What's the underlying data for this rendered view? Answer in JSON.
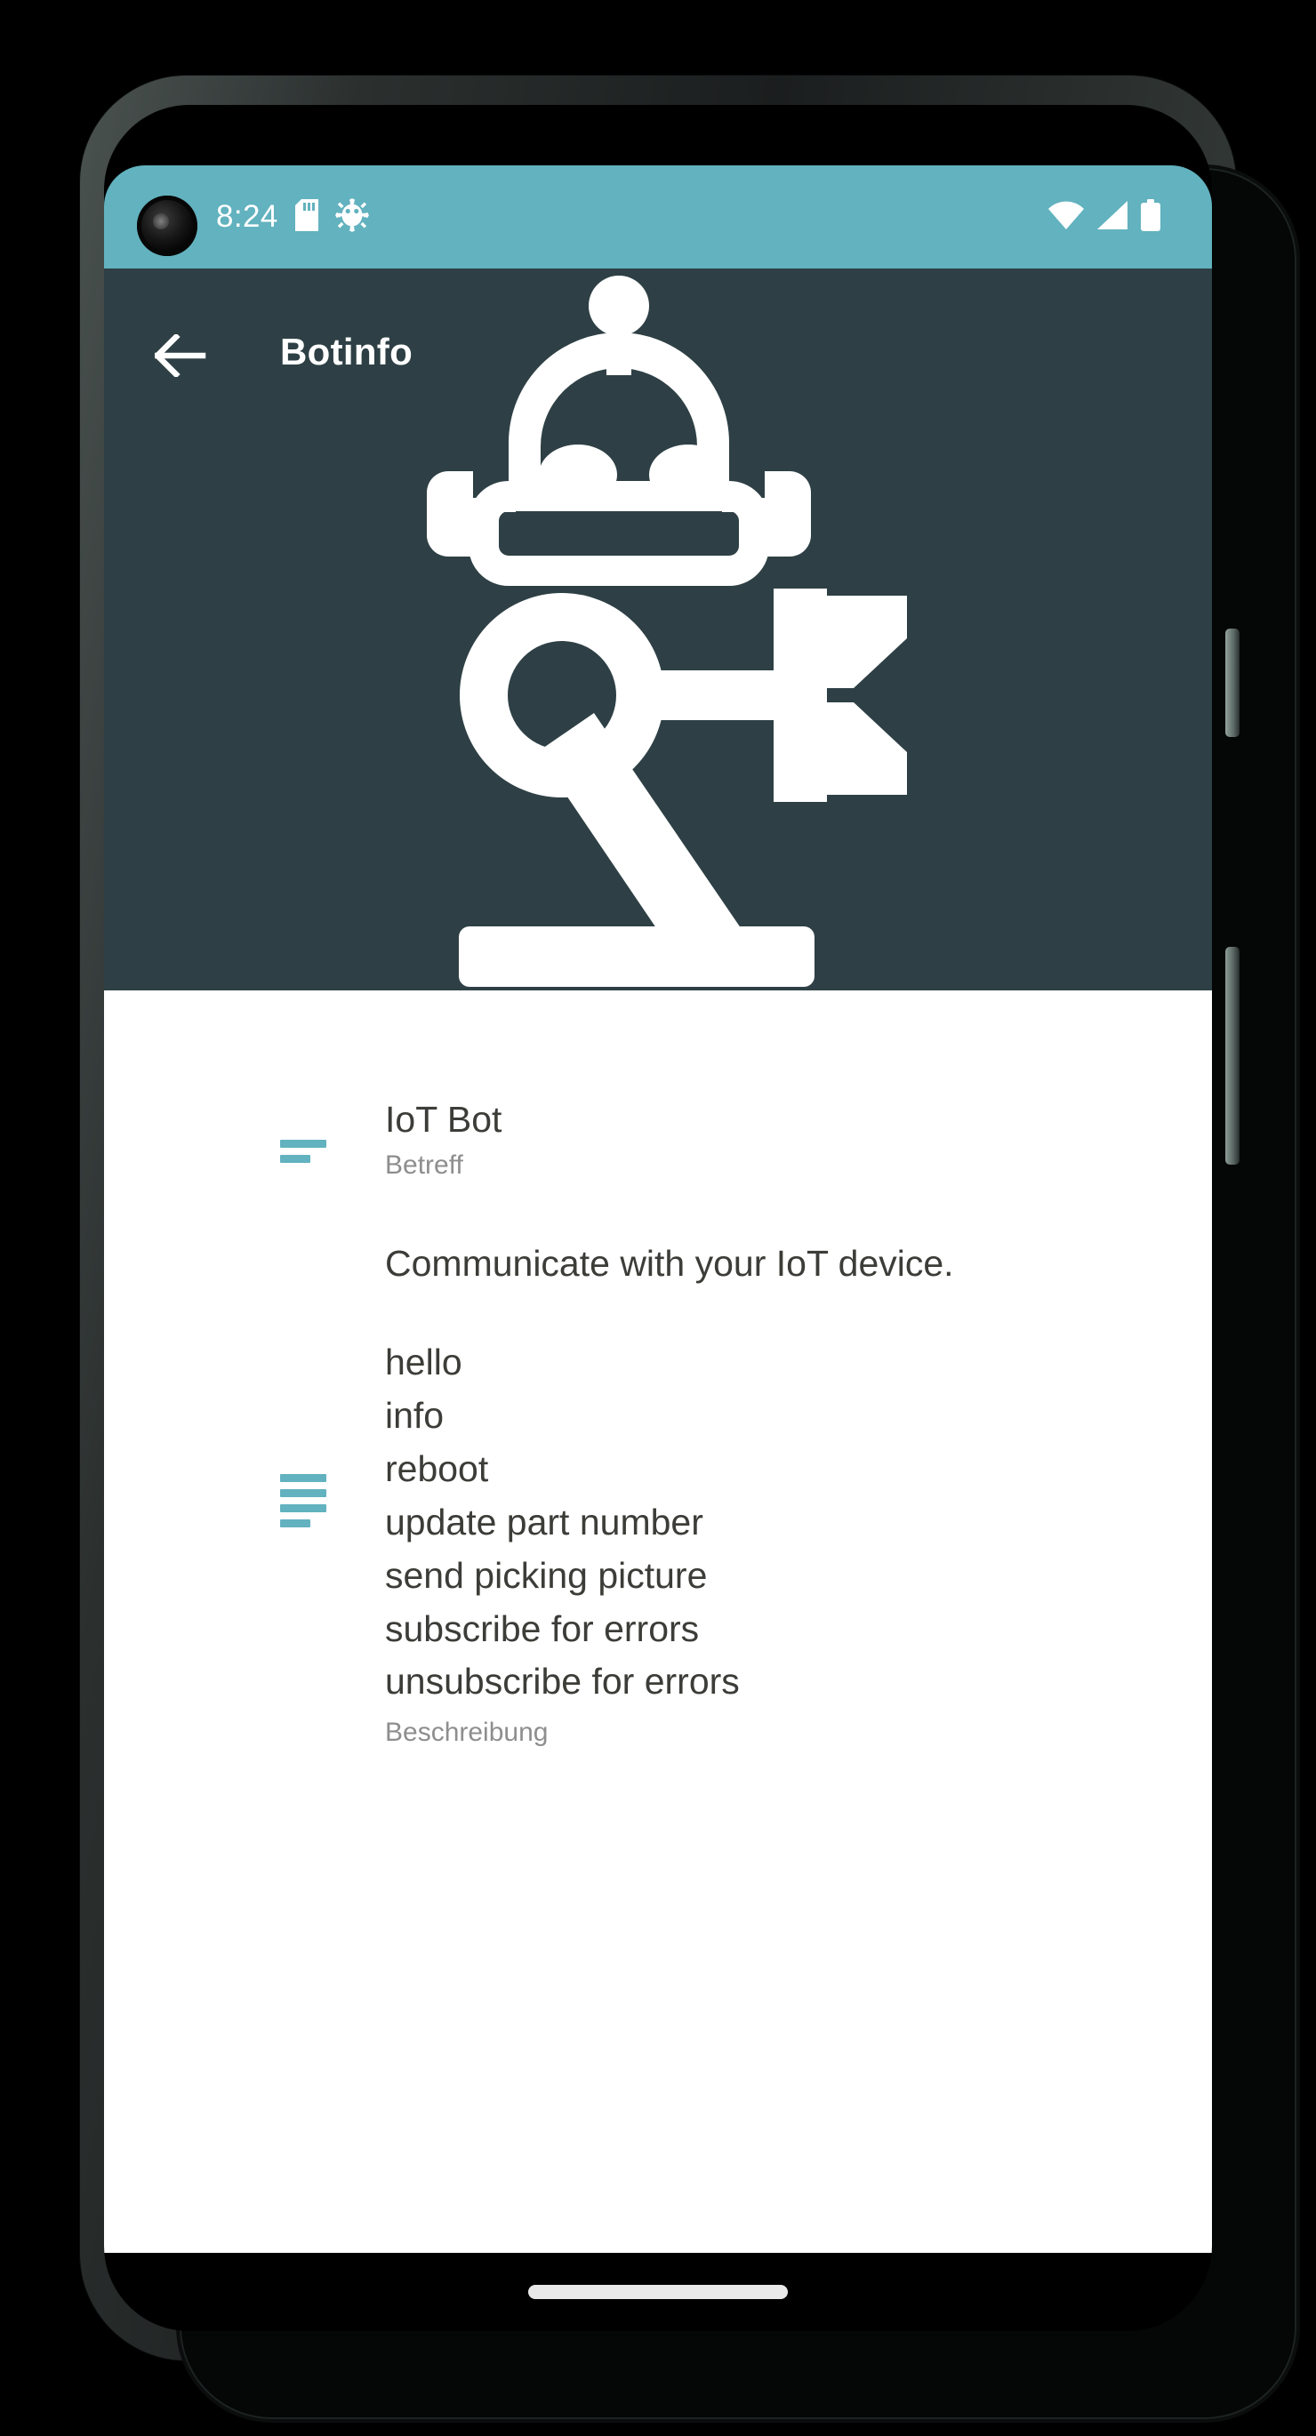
{
  "device": {
    "frame": "android-phone",
    "camera_icon": "camera-punch-hole"
  },
  "status_bar": {
    "clock": "8:24",
    "background_color": "#62b2bf",
    "left_icons": [
      "sd-card-icon",
      "bug-debug-icon"
    ],
    "right_icons": [
      "wifi-icon",
      "cellular-signal-icon",
      "battery-icon"
    ]
  },
  "app_bar": {
    "title": "Botinfo",
    "back_icon": "arrow-back-icon",
    "background_color": "#2e4045",
    "hero_image": "robot-arm-logo"
  },
  "content": {
    "background_color": "#ffffff",
    "accent_color": "#62b2bf",
    "subject": {
      "icon": "subject-lines-icon",
      "value": "IoT Bot",
      "label": "Betreff"
    },
    "description": {
      "icon": "description-lines-icon",
      "intro": "Communicate with your IoT device.",
      "commands": [
        "hello",
        "info",
        "reboot",
        "update part number",
        "send picking picture",
        "subscribe for errors",
        "unsubscribe for errors"
      ],
      "label": "Beschreibung"
    }
  },
  "navigation": {
    "gesture_pill": "home-gesture-pill"
  }
}
